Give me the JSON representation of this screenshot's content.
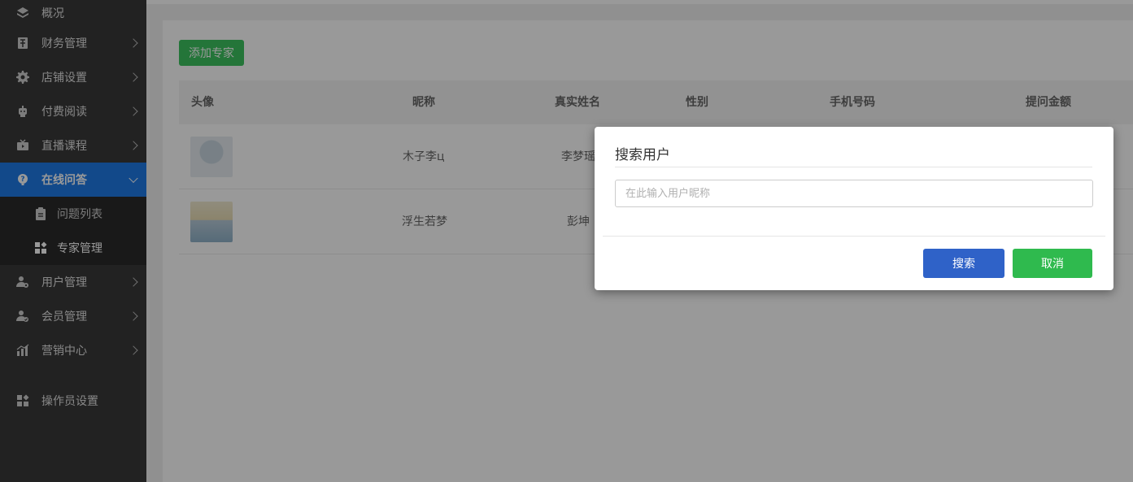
{
  "sidebar": {
    "items": [
      {
        "label": "概况",
        "icon": "layers-icon"
      },
      {
        "label": "财务管理",
        "icon": "finance-icon"
      },
      {
        "label": "店铺设置",
        "icon": "gear-icon"
      },
      {
        "label": "付费阅读",
        "icon": "robot-icon"
      },
      {
        "label": "直播课程",
        "icon": "tv-icon"
      },
      {
        "label": "在线问答",
        "icon": "question-icon"
      },
      {
        "label": "用户管理",
        "icon": "user-gear-icon"
      },
      {
        "label": "会员管理",
        "icon": "member-icon"
      },
      {
        "label": "营销中心",
        "icon": "chart-icon"
      },
      {
        "label": "操作员设置",
        "icon": "apps-icon"
      }
    ],
    "sub_items": [
      {
        "label": "问题列表",
        "icon": "clipboard-icon"
      },
      {
        "label": "专家管理",
        "icon": "apps-icon"
      }
    ]
  },
  "toolbar": {
    "add_label": "添加专家"
  },
  "table": {
    "headers": [
      "头像",
      "昵称",
      "真实姓名",
      "性别",
      "手机号码",
      "提问金额"
    ],
    "rows": [
      {
        "nickname": "木子李ц",
        "realname": "李梦瑶"
      },
      {
        "nickname": "浮生若梦",
        "realname": "彭坤"
      }
    ]
  },
  "modal": {
    "title": "搜索用户",
    "input_placeholder": "在此输入用户昵称",
    "input_value": "",
    "search_label": "搜索",
    "cancel_label": "取消"
  },
  "colors": {
    "sidebar_bg": "#393939",
    "active": "#1e7ae6",
    "search_button": "#2f62c8",
    "cancel_button": "#2fba4e",
    "add_button": "#3cc45f"
  }
}
